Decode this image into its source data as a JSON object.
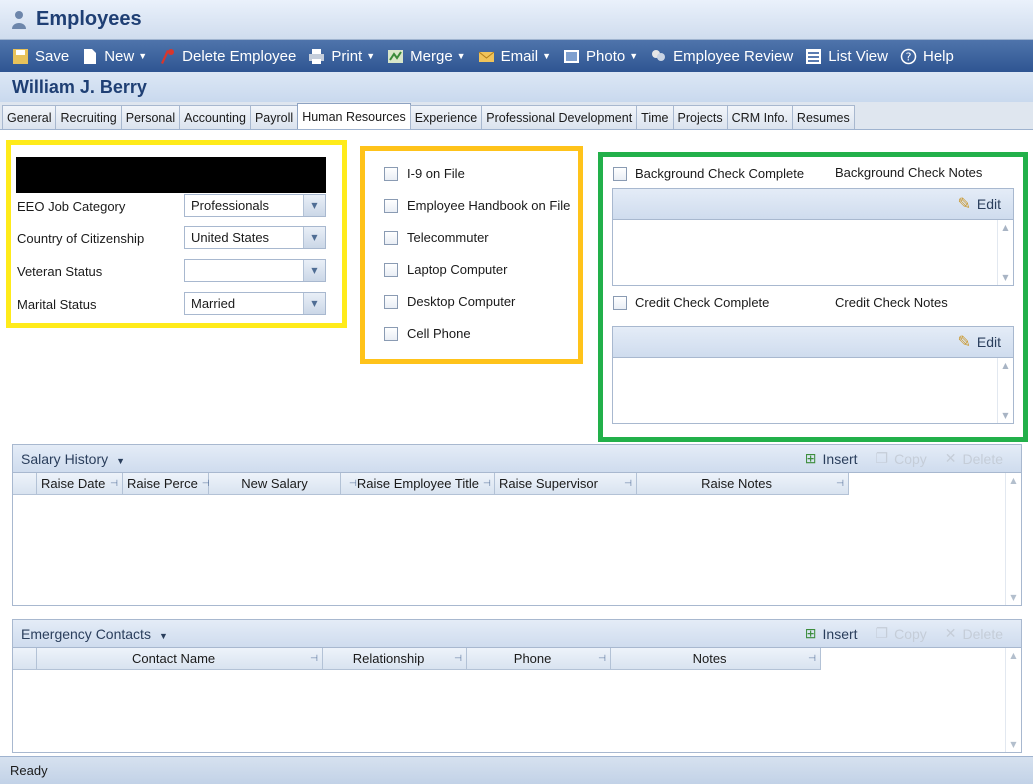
{
  "window": {
    "title": "Employees",
    "icon": "person-icon"
  },
  "toolbar": {
    "items": [
      {
        "label": "Save",
        "icon": "save-icon",
        "dropdown": false
      },
      {
        "label": "New",
        "icon": "new-document-icon",
        "dropdown": true
      },
      {
        "label": "Delete Employee",
        "icon": "delete-employee-icon",
        "dropdown": false
      },
      {
        "label": "Print",
        "icon": "printer-icon",
        "dropdown": true
      },
      {
        "label": "Merge",
        "icon": "merge-icon",
        "dropdown": true
      },
      {
        "label": "Email",
        "icon": "email-icon",
        "dropdown": true
      },
      {
        "label": "Photo",
        "icon": "photo-icon",
        "dropdown": true
      },
      {
        "label": "Employee Review",
        "icon": "review-icon",
        "dropdown": false
      },
      {
        "label": "List View",
        "icon": "list-view-icon",
        "dropdown": false
      },
      {
        "label": "Help",
        "icon": "help-icon",
        "dropdown": false
      }
    ]
  },
  "employee": {
    "name": "William J. Berry"
  },
  "tabs": [
    {
      "label": "General",
      "active": false
    },
    {
      "label": "Recruiting",
      "active": false
    },
    {
      "label": "Personal",
      "active": false
    },
    {
      "label": "Accounting",
      "active": false
    },
    {
      "label": "Payroll",
      "active": false
    },
    {
      "label": "Human Resources",
      "active": true
    },
    {
      "label": "Experience",
      "active": false
    },
    {
      "label": "Professional Development",
      "active": false
    },
    {
      "label": "Time",
      "active": false
    },
    {
      "label": "Projects",
      "active": false
    },
    {
      "label": "CRM Info.",
      "active": false
    },
    {
      "label": "Resumes",
      "active": false
    }
  ],
  "hr_fields": [
    {
      "label": "EEO Job Category",
      "value": "Professionals"
    },
    {
      "label": "Country of Citizenship",
      "value": "United States"
    },
    {
      "label": "Veteran Status",
      "value": ""
    },
    {
      "label": "Marital Status",
      "value": "Married"
    }
  ],
  "checklist": [
    {
      "label": "I-9 on File",
      "checked": false
    },
    {
      "label": "Employee Handbook on File",
      "checked": false
    },
    {
      "label": "Telecommuter",
      "checked": false
    },
    {
      "label": "Laptop Computer",
      "checked": false
    },
    {
      "label": "Desktop Computer",
      "checked": false
    },
    {
      "label": "Cell Phone",
      "checked": false
    }
  ],
  "checks": {
    "background": {
      "complete_label": "Background Check Complete",
      "notes_label": "Background Check Notes",
      "edit_label": "Edit",
      "checked": false
    },
    "credit": {
      "complete_label": "Credit Check Complete",
      "notes_label": "Credit Check Notes",
      "edit_label": "Edit",
      "checked": false
    }
  },
  "salary_history": {
    "title": "Salary History",
    "actions": {
      "insert": "Insert",
      "copy": "Copy",
      "delete": "Delete"
    },
    "columns": [
      "Raise Date",
      "Raise Perce",
      "New Salary",
      "Raise Employee Title",
      "Raise Supervisor",
      "Raise Notes"
    ]
  },
  "emergency_contacts": {
    "title": "Emergency Contacts",
    "actions": {
      "insert": "Insert",
      "copy": "Copy",
      "delete": "Delete"
    },
    "columns": [
      "Contact Name",
      "Relationship",
      "Phone",
      "Notes"
    ]
  },
  "status": {
    "text": "Ready"
  },
  "colors": {
    "toolbar": "#2f5592",
    "title": "#1f3f74",
    "highlight_yellow": "#ffeb1a",
    "highlight_orange": "#ffc31a",
    "highlight_green": "#22b04a"
  }
}
